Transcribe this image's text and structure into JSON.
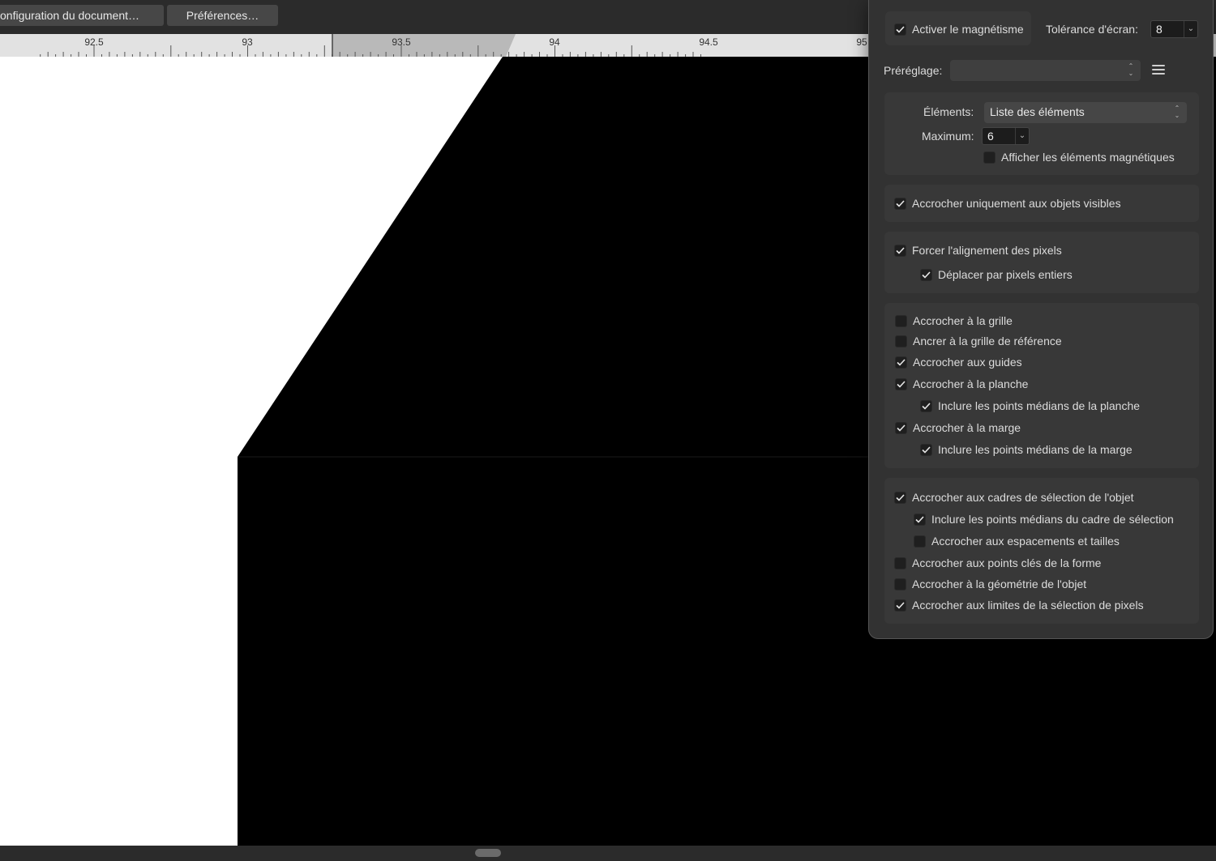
{
  "toolbar": {
    "doc_setup_label": "onfiguration du document…",
    "preferences_label": "Préférences…"
  },
  "ruler": {
    "labels": [
      "92.5",
      "93",
      "93.5",
      "94",
      "94.5",
      "95"
    ]
  },
  "snapping": {
    "enable_label": "Activer le magnétisme",
    "enable_checked": true,
    "tolerance_label": "Tolérance d'écran:",
    "tolerance_value": "8",
    "preset_label": "Préréglage:",
    "preset_value": "",
    "candidates_label": "Éléments:",
    "candidates_value": "Liste des éléments",
    "maximum_label": "Maximum:",
    "maximum_value": "6",
    "options": [
      {
        "label": "Afficher les éléments magnétiques",
        "checked": false
      },
      {
        "label": "Accrocher uniquement aux objets visibles",
        "checked": true
      },
      {
        "label": "Forcer l'alignement des pixels",
        "checked": true
      },
      {
        "label": "Déplacer par pixels entiers",
        "checked": true
      },
      {
        "label": "Accrocher à la grille",
        "checked": false
      },
      {
        "label": "Ancrer à la grille de référence",
        "checked": false
      },
      {
        "label": "Accrocher aux guides",
        "checked": true
      },
      {
        "label": "Accrocher à la planche",
        "checked": true
      },
      {
        "label": "Inclure les points médians de la planche",
        "checked": true
      },
      {
        "label": "Accrocher à la marge",
        "checked": true
      },
      {
        "label": "Inclure les points médians de la marge",
        "checked": true
      },
      {
        "label": "Accrocher aux cadres de sélection de l'objet",
        "checked": true
      },
      {
        "label": "Inclure les points médians du cadre de sélection",
        "checked": true
      },
      {
        "label": "Accrocher aux espacements et tailles",
        "checked": false
      },
      {
        "label": "Accrocher aux points clés de la forme",
        "checked": false
      },
      {
        "label": "Accrocher à la géométrie de l'objet",
        "checked": false
      },
      {
        "label": "Accrocher aux limites de la sélection de pixels",
        "checked": true
      }
    ]
  }
}
